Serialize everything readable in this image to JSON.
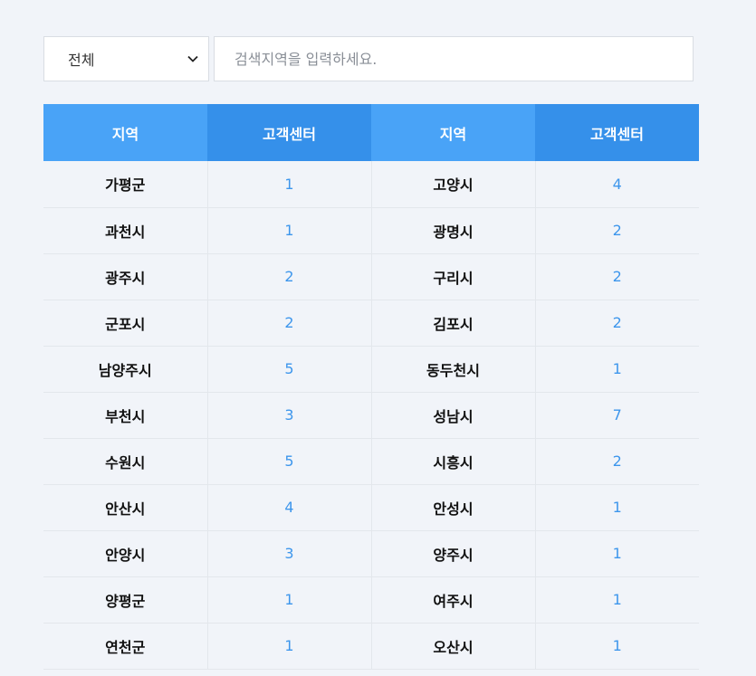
{
  "filter": {
    "select_value": "전체",
    "search_placeholder": "검색지역을 입력하세요."
  },
  "table": {
    "headers": [
      "지역",
      "고객센터",
      "지역",
      "고객센터"
    ],
    "rows": [
      {
        "region_a": "가평군",
        "count_a": "1",
        "region_b": "고양시",
        "count_b": "4"
      },
      {
        "region_a": "과천시",
        "count_a": "1",
        "region_b": "광명시",
        "count_b": "2"
      },
      {
        "region_a": "광주시",
        "count_a": "2",
        "region_b": "구리시",
        "count_b": "2"
      },
      {
        "region_a": "군포시",
        "count_a": "2",
        "region_b": "김포시",
        "count_b": "2"
      },
      {
        "region_a": "남양주시",
        "count_a": "5",
        "region_b": "동두천시",
        "count_b": "1"
      },
      {
        "region_a": "부천시",
        "count_a": "3",
        "region_b": "성남시",
        "count_b": "7"
      },
      {
        "region_a": "수원시",
        "count_a": "5",
        "region_b": "시흥시",
        "count_b": "2"
      },
      {
        "region_a": "안산시",
        "count_a": "4",
        "region_b": "안성시",
        "count_b": "1"
      },
      {
        "region_a": "안양시",
        "count_a": "3",
        "region_b": "양주시",
        "count_b": "1"
      },
      {
        "region_a": "양평군",
        "count_a": "1",
        "region_b": "여주시",
        "count_b": "1"
      },
      {
        "region_a": "연천군",
        "count_a": "1",
        "region_b": "오산시",
        "count_b": "1"
      }
    ]
  },
  "colors": {
    "header_light": "#49a3f7",
    "header_dark": "#3590ea",
    "count_text": "#3d96ec",
    "background": "#f1f4f9"
  },
  "icons": {
    "select_arrow": "chevron-down-icon"
  }
}
